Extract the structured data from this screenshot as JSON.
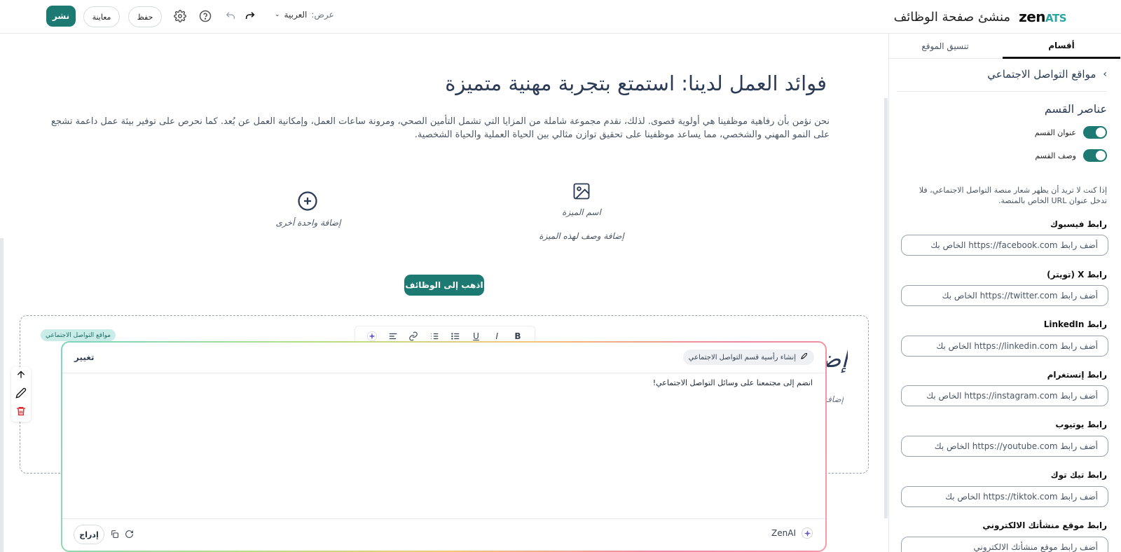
{
  "brand": {
    "logo_main": "zen",
    "logo_accent": "ATS",
    "title": "منشئ صفحة الوظائف"
  },
  "toolbar": {
    "publish_label": "نشر",
    "preview_label": "معاينة",
    "save_label": "حفظ",
    "view_label": "عرض:",
    "view_value": "العربية"
  },
  "hero": {
    "title": "فوائد العمل لدينا: استمتع بتجربة مهنية متميزة",
    "description": "نحن نؤمن بأن رفاهية موظفينا هي أولوية قصوى. لذلك، نقدم مجموعة شاملة من المزايا التي تشمل التأمين الصحي، ومرونة ساعات العمل، وإمكانية العمل عن بُعد. كما نحرص على توفير بيئة عمل داعمة تشجع على النمو المهني والشخصي، مما يساعد موظفينا على تحقيق توازن مثالي بين الحياة العملية والحياة الشخصية."
  },
  "benefits": {
    "item_name": "اسم الميزة",
    "item_desc": "إضافة وصف لهذه الميزة",
    "add_another": "إضافة واحدة أخرى"
  },
  "jobs_button": "اذهب إلى الوظائف",
  "social_section": {
    "chip": "مواقع التواصل الاجتماعي",
    "ghost_title": "إضافة",
    "ghost_sub": "إضافة"
  },
  "format_bar": {
    "bold": "B",
    "italic": "I",
    "underline": "U"
  },
  "ai_modal": {
    "change_label": "تغيير",
    "prompt_chip": "إنشاء رأسية قسم التواصل الاجتماعي",
    "generated_text": "انضم إلى مجتمعنا على وسائل التواصل الاجتماعي!",
    "insert_label": "إدراج",
    "brand": "ZenAI"
  },
  "panel": {
    "tabs": [
      {
        "label": "أقسام"
      },
      {
        "label": "تنسيق الموقع"
      }
    ],
    "back_title": "مواقع التواصل الاجتماعي",
    "section_elements": "عناصر القسم",
    "toggles": [
      {
        "label": "عنوان القسم",
        "on": true
      },
      {
        "label": "وصف القسم",
        "on": true
      }
    ],
    "help": "إذا كنت لا تريد أن يظهر شعار منصة التواصل الاجتماعي، فلا تدخل عنوان URL الخاص بالمنصة.",
    "fields": [
      {
        "label": "رابط فيسبوك",
        "placeholder": "أضف رابط https://facebook.com الخاص بك"
      },
      {
        "label": "رابط X (تويتر)",
        "placeholder": "أضف رابط https://twitter.com الخاص بك"
      },
      {
        "label": "رابط LinkedIn",
        "placeholder": "أضف رابط https://linkedin.com الخاص بك"
      },
      {
        "label": "رابط إنستغرام",
        "placeholder": "أضف رابط https://instagram.com الخاص بك"
      },
      {
        "label": "رابط يوتيوب",
        "placeholder": "أضف رابط https://youtube.com الخاص بك"
      },
      {
        "label": "رابط تيك توك",
        "placeholder": "أضف رابط https://tiktok.com الخاص بك"
      },
      {
        "label": "رابط موقع منشأتك الالكتروني",
        "placeholder": "أضف رابط موقع منشأتك الالكتروني"
      }
    ]
  },
  "colors": {
    "brand_teal": "#1c7a72",
    "heading": "#2b3a55",
    "chip_bg": "#c9ece8"
  }
}
